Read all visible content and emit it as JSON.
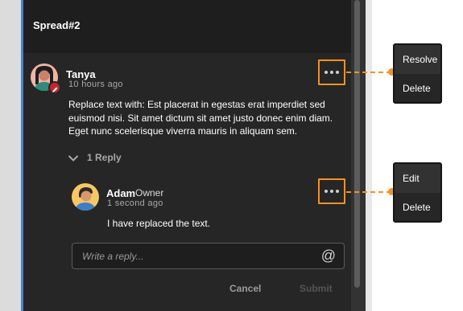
{
  "panel": {
    "title": "Spread#2"
  },
  "comment": {
    "author": "Tanya",
    "time": "10 hours ago",
    "text_lines": [
      "Replace text with: Est placerat in egestas erat imperdiet sed",
      "euismod nisi. Sit amet dictum sit amet justo donec enim diam.",
      "Eget nunc scelerisque viverra mauris in aliquam sem."
    ],
    "more_icon": "ellipsis-icon"
  },
  "replies": {
    "toggle_label": "1 Reply",
    "chevron_icon": "chevron-down-icon"
  },
  "reply": {
    "author": "Adam",
    "role": "Owner",
    "time": "1 second ago",
    "text": "I have replaced the text.",
    "more_icon": "ellipsis-icon"
  },
  "reply_input": {
    "placeholder": "Write a reply...",
    "mention_icon": "@"
  },
  "actions": {
    "cancel": "Cancel",
    "submit": "Submit"
  },
  "comment_menu": {
    "items": [
      "Resolve",
      "Delete"
    ]
  },
  "reply_menu": {
    "items": [
      "Edit",
      "Delete"
    ]
  },
  "colors": {
    "highlight": "#f5921e",
    "panel": "#262626",
    "header": "#1e1e1e",
    "badge": "#c8232c",
    "selection_stripe": "#4a7fd1"
  }
}
